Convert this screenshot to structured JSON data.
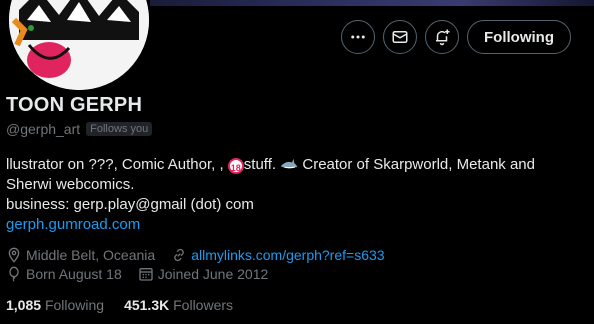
{
  "profile": {
    "display_name": "TOON GERPH",
    "handle": "@gerph_art",
    "follows_you": "Follows you",
    "bio": {
      "line1_a": "llustrator on ???, Comic Author, , ",
      "line1_b": "stuff. ",
      "line1_c": " Creator of Skarpworld, Metank and",
      "line2": "Sherwi webcomics.",
      "line3": "business: gerp.play@gmail (dot) com",
      "line4_link": "gerph.gumroad.com"
    },
    "emoji_18_label": "18",
    "location": "Middle Belt, Oceania",
    "website": "allmylinks.com/gerph?ref=s633",
    "birthday": "Born August 18",
    "joined": "Joined June 2012",
    "following_count": "1,085",
    "following_label": "Following",
    "followers_count": "451.3K",
    "followers_label": "Followers"
  },
  "actions": {
    "follow_button_label": "Following"
  },
  "colors": {
    "background": "#000000",
    "text_primary": "#e7e9ea",
    "text_secondary": "#71767b",
    "link": "#1d9bf0",
    "border": "#536471"
  },
  "icons": [
    "more-icon",
    "message-icon",
    "notification-bell-icon",
    "location-pin-icon",
    "link-icon",
    "balloon-icon",
    "calendar-icon",
    "shark-emoji",
    "no-under-18-emoji"
  ]
}
